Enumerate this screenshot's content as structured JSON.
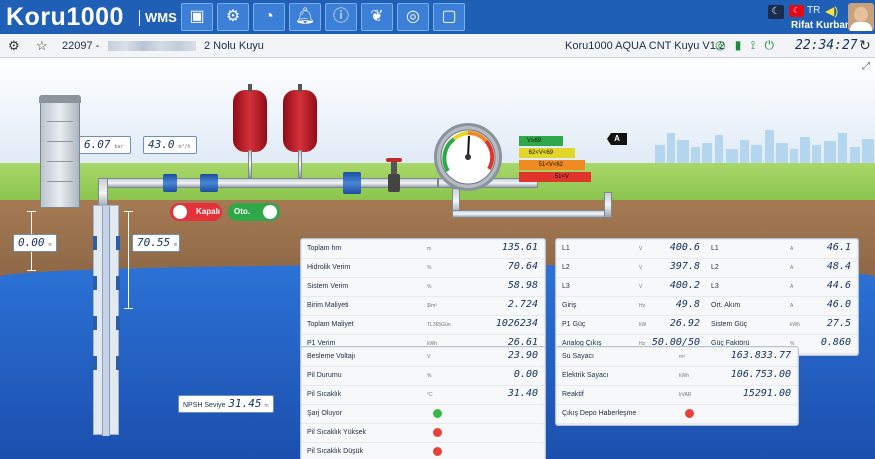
{
  "header": {
    "brand": "Koru1000",
    "product": "WMS",
    "nav_icons": [
      "image-icon",
      "gears-icon",
      "pie-chart-icon",
      "bell-icon",
      "info-icon",
      "leaf-icon",
      "chat-icon",
      "picture-icon"
    ],
    "lang": "TR",
    "user_name": "Rifat Kurban"
  },
  "subheader": {
    "well_id": "22097 -",
    "well_name": "2 Nolu Kuyu",
    "device_model": "Koru1000 AQUA CNT Kuyu V1.2",
    "clock": "22:34:27"
  },
  "scene": {
    "pressure1": {
      "value": "6.07",
      "unit": "bar"
    },
    "flow": {
      "value": "43.0",
      "unit": "m³/h"
    },
    "static_level": {
      "value": "0.00",
      "unit": "m"
    },
    "dynamic_level": {
      "value": "70.55",
      "unit": "m"
    },
    "npsh": {
      "label": "NPSH Seviye",
      "value": "31.45",
      "unit": "m"
    },
    "toggle_closed": "Kapalı",
    "toggle_auto": "Oto.",
    "tag_letter": "A",
    "levels": [
      {
        "label": "V≥69",
        "color": "#2fa84a"
      },
      {
        "label": "62<V<69",
        "color": "#e2d62a"
      },
      {
        "label": "51<V<62",
        "color": "#f08a22"
      },
      {
        "label": "51<V",
        "color": "#e0352b"
      }
    ]
  },
  "panel_left": [
    {
      "label": "Toplam hm",
      "unit": "m",
      "value": "135.61"
    },
    {
      "label": "Hidrolik Verim",
      "unit": "%",
      "value": "70.64"
    },
    {
      "label": "Sistem Verim",
      "unit": "%",
      "value": "58.98"
    },
    {
      "label": "Birim Maliyeti",
      "unit": "$/m³",
      "value": "2.724"
    },
    {
      "label": "Toplam Maliyet",
      "unit": "TL365Gün",
      "value": "1026234"
    },
    {
      "label": "P1 Verim",
      "unit": "kWh",
      "value": "26.61"
    }
  ],
  "panel_elec": [
    {
      "l1": "L1",
      "u1": "V",
      "v1": "400.6",
      "l2": "L1",
      "u2": "A",
      "v2": "46.1"
    },
    {
      "l1": "L2",
      "u1": "V",
      "v1": "397.8",
      "l2": "L2",
      "u2": "A",
      "v2": "48.4"
    },
    {
      "l1": "L3",
      "u1": "V",
      "v1": "400.2",
      "l2": "L3",
      "u2": "A",
      "v2": "44.6"
    },
    {
      "l1": "Giriş",
      "u1": "Hz",
      "v1": "49.8",
      "l2": "Ort. Akım",
      "u2": "A",
      "v2": "46.0"
    },
    {
      "l1": "P1 Güç",
      "u1": "kW",
      "v1": "26.92",
      "l2": "Sistem Güç",
      "u2": "kWh",
      "v2": "27.5"
    },
    {
      "l1": "Analog Çıkış",
      "u1": "Hz",
      "v1": "50.00/50",
      "l2": "Güç Faktörü",
      "u2": "%",
      "v2": "0.860"
    }
  ],
  "panel_battery": [
    {
      "label": "Besleme Voltajı",
      "unit": "V",
      "value": "23.90"
    },
    {
      "label": "Pil Durumu",
      "unit": "%",
      "value": "0.00"
    },
    {
      "label": "Pil Sıcaklık",
      "unit": "°C",
      "value": "31.40"
    },
    {
      "label": "Şarj Oluyor",
      "status": "#3bb54a"
    },
    {
      "label": "Pil Sıcaklık Yüksek",
      "status": "#e8413c"
    },
    {
      "label": "Pil Sıcaklık Düşük",
      "status": "#e8413c"
    }
  ],
  "panel_meters": [
    {
      "label": "Su Sayacı",
      "unit": "m³",
      "value": "163.833.77"
    },
    {
      "label": "Elektrik Sayacı",
      "unit": "kWh",
      "value": "106.753.00"
    },
    {
      "label": "Reaktif",
      "unit": "kVAR",
      "value": "15291.00"
    },
    {
      "label": "Çıkış Depo Haberleşme",
      "status": "#e8413c"
    }
  ]
}
